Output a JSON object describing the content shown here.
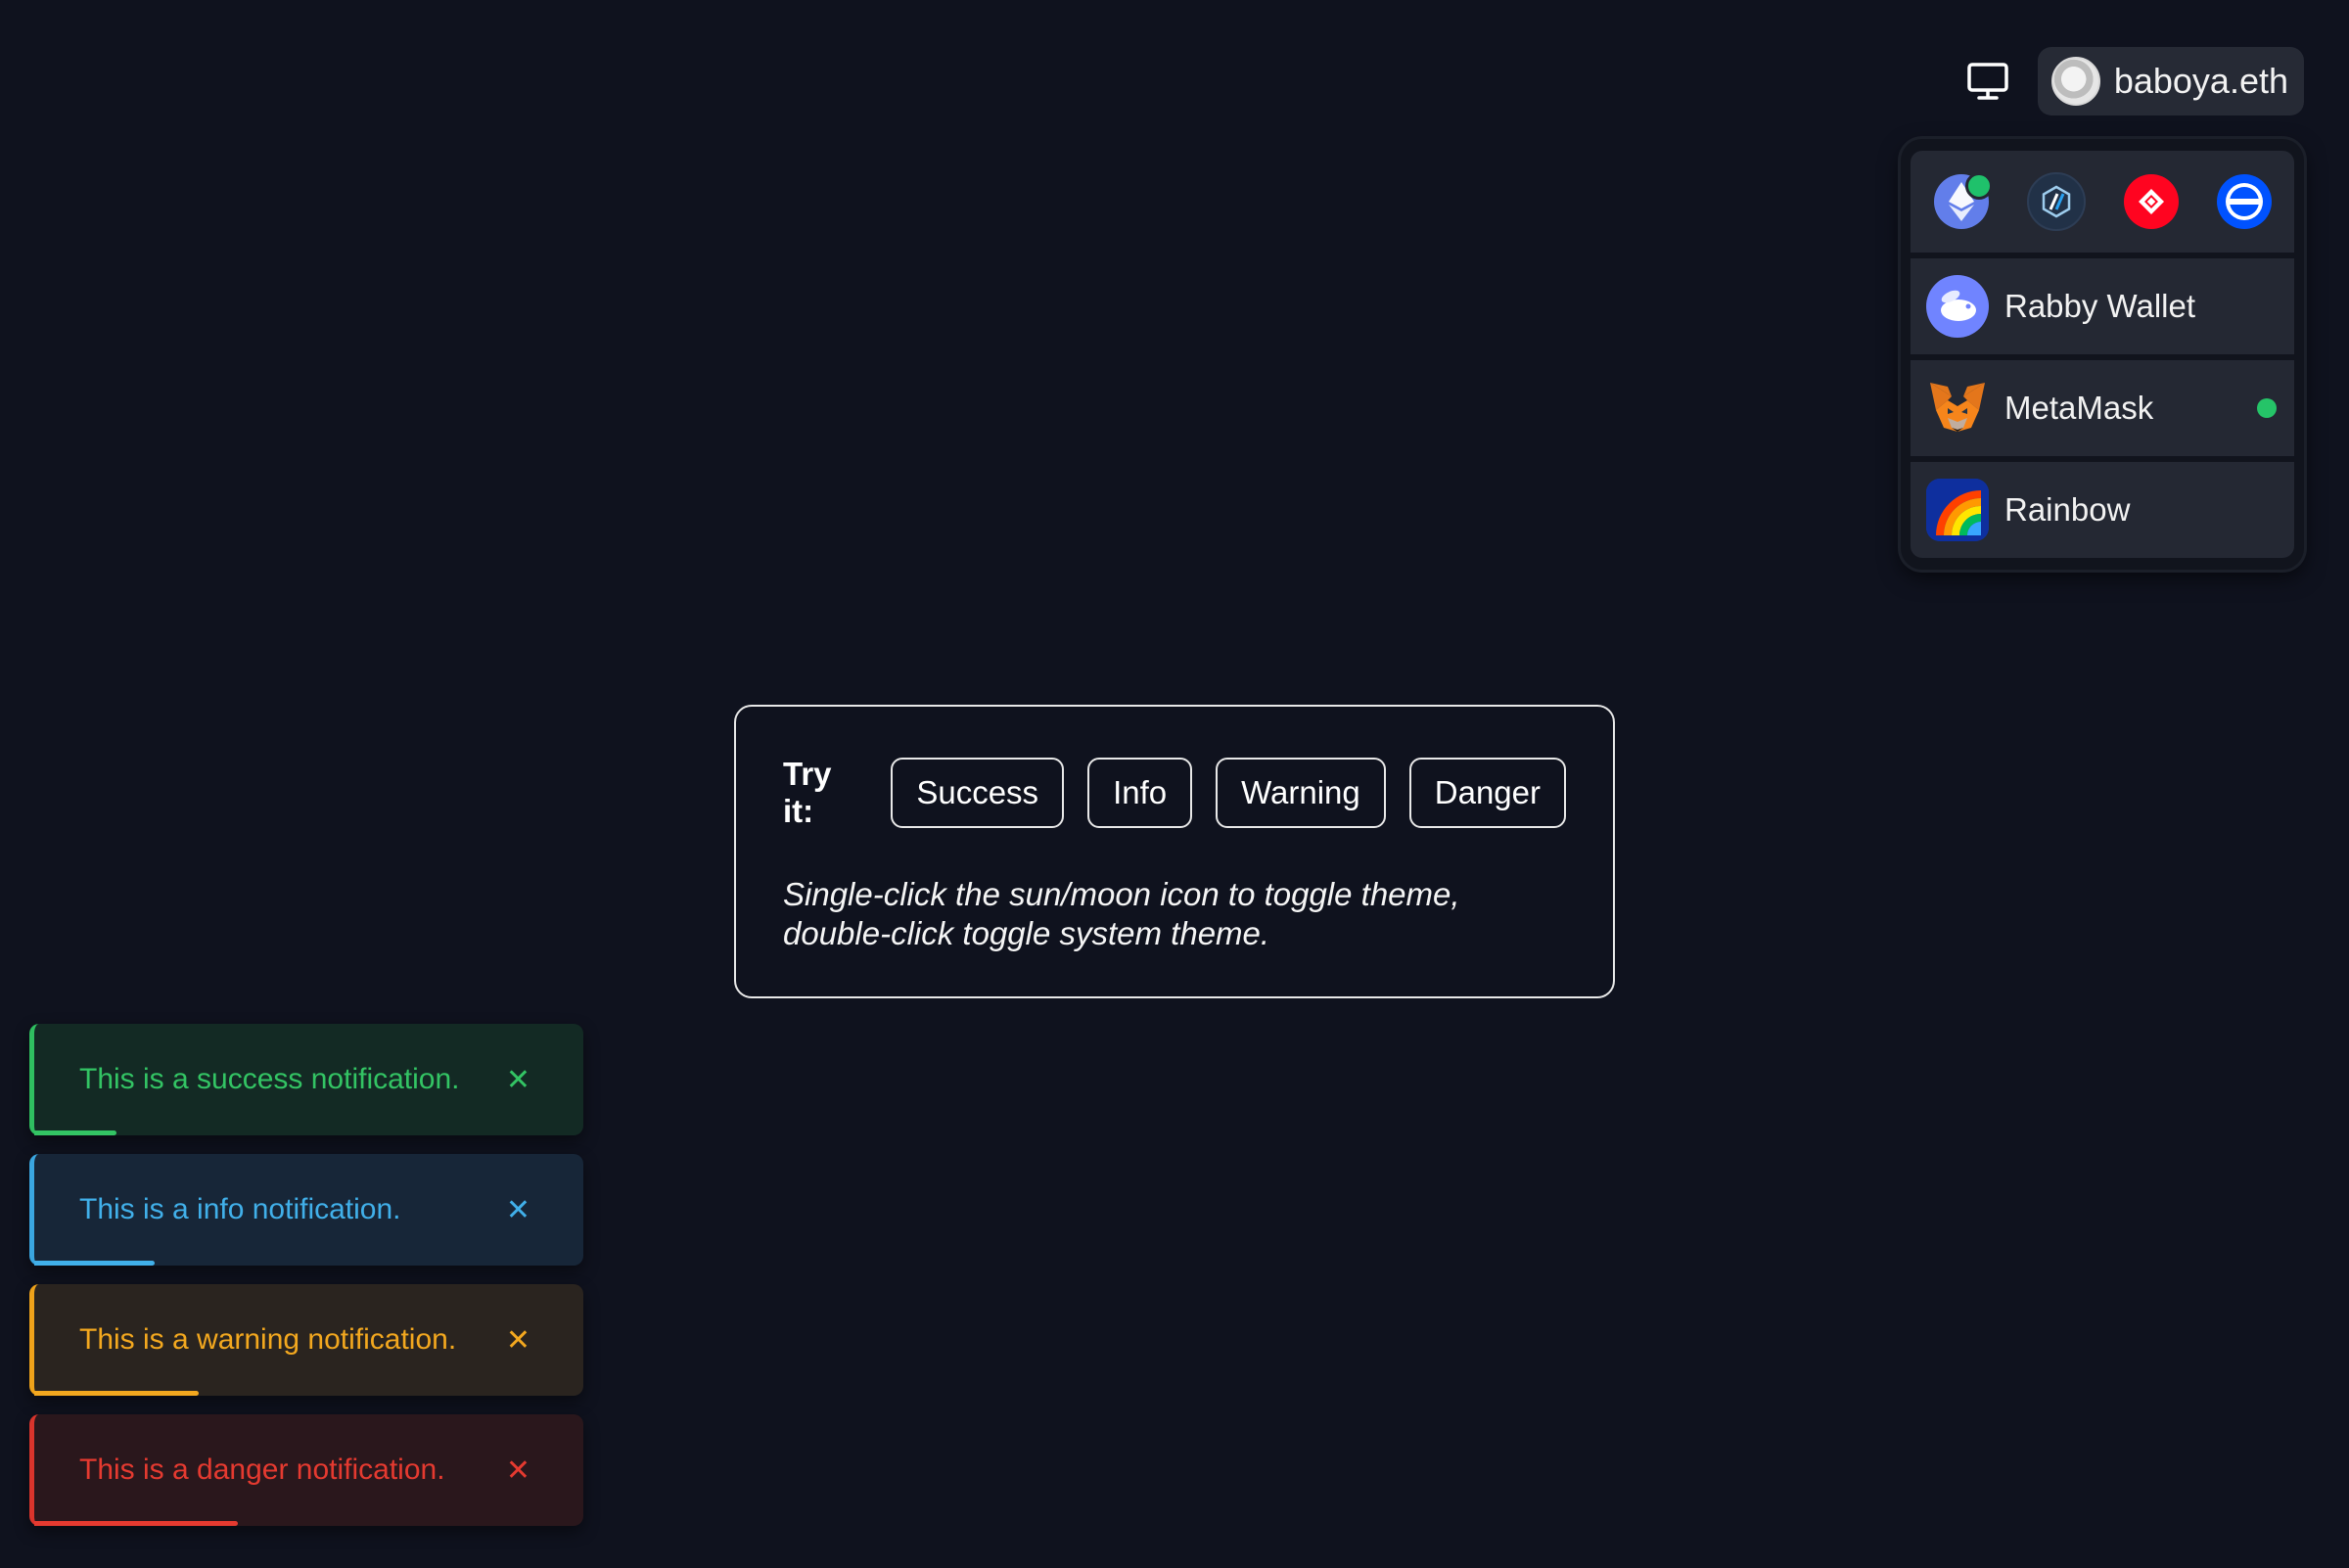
{
  "header": {
    "theme_icon": "monitor-icon",
    "account": {
      "name": "baboya.eth",
      "avatar": "avatar"
    }
  },
  "wallet_panel": {
    "chains": [
      {
        "name": "ethereum",
        "icon": "ethereum-icon",
        "active": true
      },
      {
        "name": "arbitrum",
        "icon": "arbitrum-icon",
        "active": false
      },
      {
        "name": "optimism",
        "icon": "optimism-icon",
        "active": false
      },
      {
        "name": "base",
        "icon": "base-icon",
        "active": false
      }
    ],
    "wallets": [
      {
        "label": "Rabby Wallet",
        "icon": "rabby-icon",
        "connected": false
      },
      {
        "label": "MetaMask",
        "icon": "metamask-icon",
        "connected": true
      },
      {
        "label": "Rainbow",
        "icon": "rainbow-icon",
        "connected": false
      }
    ]
  },
  "tryit": {
    "label": "Try it:",
    "buttons": {
      "success": "Success",
      "info": "Info",
      "warning": "Warning",
      "danger": "Danger"
    },
    "description": "Single-click the sun/moon icon to toggle theme, double-click toggle system theme."
  },
  "toasts": [
    {
      "type": "success",
      "text": "This is a success notification.",
      "close": "✕",
      "progress": 0.15,
      "color": "#33c464"
    },
    {
      "type": "info",
      "text": "This is a info notification.",
      "close": "✕",
      "progress": 0.22,
      "color": "#41b0ea"
    },
    {
      "type": "warning",
      "text": "This is a warning notification.",
      "close": "✕",
      "progress": 0.3,
      "color": "#f3a81f"
    },
    {
      "type": "danger",
      "text": "This is a danger notification.",
      "close": "✕",
      "progress": 0.37,
      "color": "#e53a30"
    }
  ]
}
